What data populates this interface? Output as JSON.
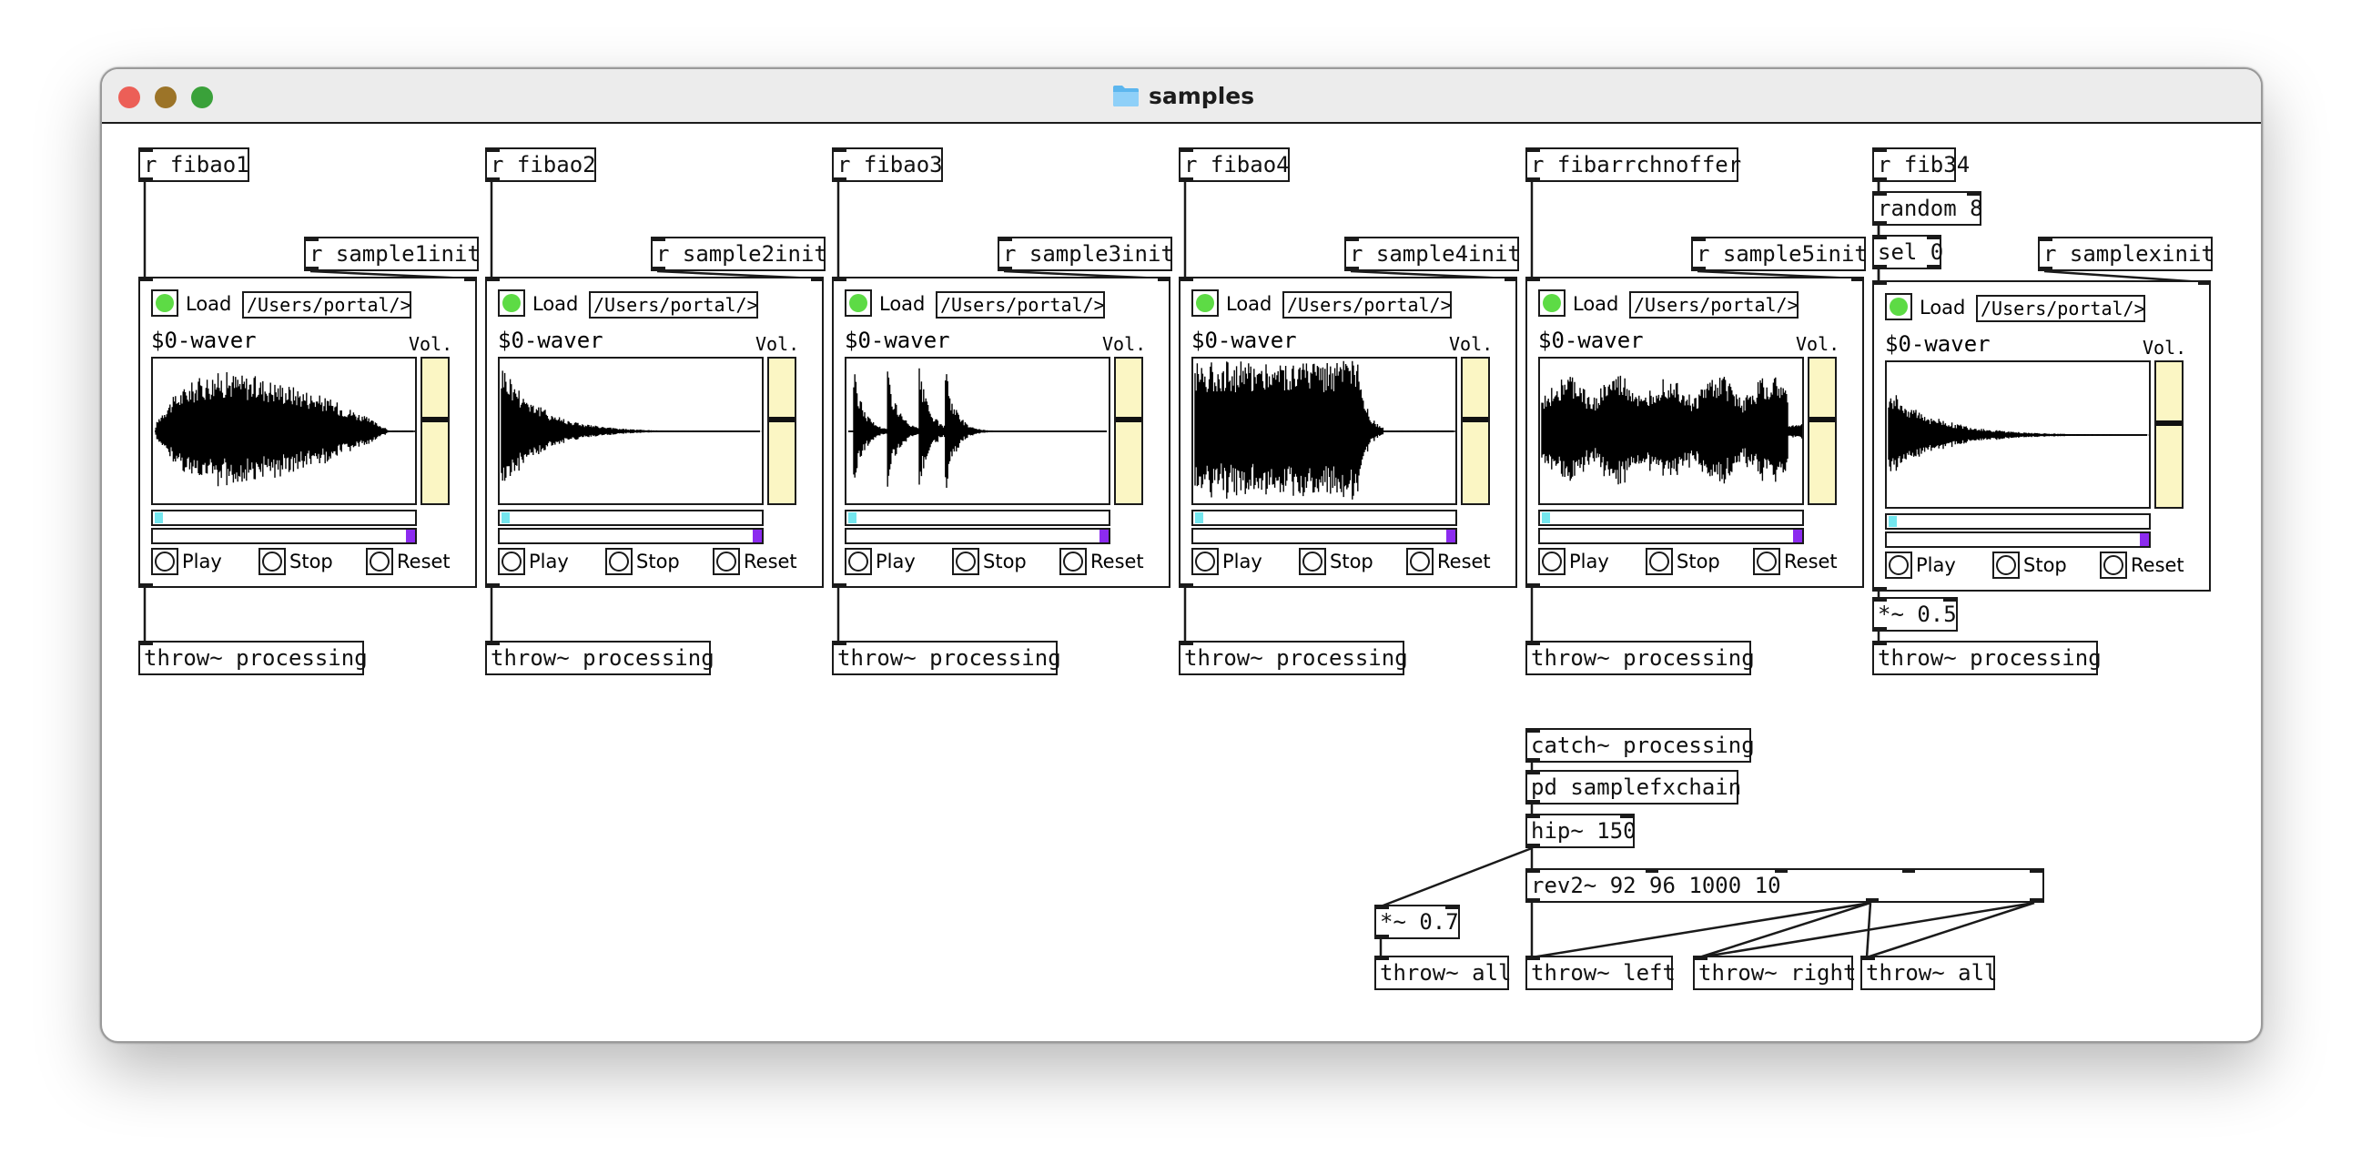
{
  "window": {
    "title": "samples",
    "title_icon": "folder-icon",
    "traffic_lights": {
      "close": "#ec5f57",
      "minimize": "#9c7428",
      "zoom": "#3aa13a"
    }
  },
  "colors": {
    "toggle_on": "#5ddb45",
    "slider_bg": "#fbf6c4",
    "playhead": "#74e6ee",
    "range_end": "#8c2bef"
  },
  "players": [
    {
      "receive": "r fibao1",
      "init": "r sample1init",
      "load_label": "Load",
      "path": "/Users/portal/>",
      "array": "$0-waver",
      "vol_label": "Vol.",
      "play": "Play",
      "stop": "Stop",
      "reset": "Reset",
      "throw": "throw~ processing",
      "volume": 0.58
    },
    {
      "receive": "r fibao2",
      "init": "r sample2init",
      "load_label": "Load",
      "path": "/Users/portal/>",
      "array": "$0-waver",
      "vol_label": "Vol.",
      "play": "Play",
      "stop": "Stop",
      "reset": "Reset",
      "throw": "throw~ processing",
      "volume": 0.58
    },
    {
      "receive": "r fibao3",
      "init": "r sample3init",
      "load_label": "Load",
      "path": "/Users/portal/>",
      "array": "$0-waver",
      "vol_label": "Vol.",
      "play": "Play",
      "stop": "Stop",
      "reset": "Reset",
      "throw": "throw~ processing",
      "volume": 0.58
    },
    {
      "receive": "r fibao4",
      "init": "r sample4init",
      "load_label": "Load",
      "path": "/Users/portal/>",
      "array": "$0-waver",
      "vol_label": "Vol.",
      "play": "Play",
      "stop": "Stop",
      "reset": "Reset",
      "throw": "throw~ processing",
      "volume": 0.58
    },
    {
      "receive": "r fibarrchnoffer",
      "init": "r sample5init",
      "load_label": "Load",
      "path": "/Users/portal/>",
      "array": "$0-waver",
      "vol_label": "Vol.",
      "play": "Play",
      "stop": "Stop",
      "reset": "Reset",
      "throw": "throw~ processing",
      "volume": 0.58
    },
    {
      "receive": "r fib34",
      "init": "r samplexinit",
      "load_label": "Load",
      "path": "/Users/portal/>",
      "array": "$0-waver",
      "vol_label": "Vol.",
      "play": "Play",
      "stop": "Stop",
      "reset": "Reset",
      "throw": "throw~ processing",
      "volume": 0.58
    }
  ],
  "extra_objects": {
    "random": "random 8",
    "sel": "sel 0",
    "mul_half": "*~ 0.5"
  },
  "fx": {
    "catch": "catch~ processing",
    "chain": "pd samplefxchain",
    "hip": "hip~ 150",
    "rev": "rev2~ 92 96 1000 10",
    "mul": "*~ 0.7",
    "throw_all_1": "throw~ all",
    "throw_left": "throw~ left",
    "throw_right": "throw~ right",
    "throw_all_2": "throw~ all"
  }
}
